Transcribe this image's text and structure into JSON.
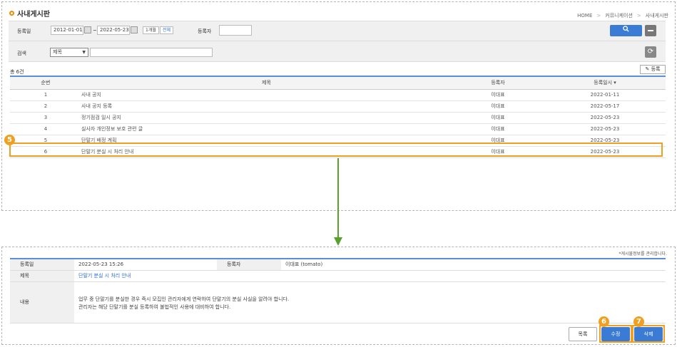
{
  "header": {
    "title": "사내게시판",
    "breadcrumb": [
      "HOME",
      "커뮤니케이션",
      "사내게시판"
    ]
  },
  "search": {
    "date_label": "등록일",
    "date_from": "2012-01-01",
    "date_to": "2022-05-23",
    "tilde": "~",
    "btn_month": "1개월",
    "btn_all": "전체",
    "writer_label": "등록자",
    "writer_value": "",
    "search_label": "검색",
    "search_select": "제목",
    "search_value": "",
    "search_icon": "search-icon",
    "refresh_icon": "refresh-icon"
  },
  "list": {
    "count": "총 6건",
    "register_button": "등록",
    "columns": [
      "순번",
      "제목",
      "등록자",
      "등록일시 ▾"
    ],
    "rows": [
      {
        "no": "1",
        "title": "사내 공지",
        "writer": "이대표",
        "date": "2022-01-11"
      },
      {
        "no": "2",
        "title": "사내 공지 등록",
        "writer": "이대표",
        "date": "2022-05-17"
      },
      {
        "no": "3",
        "title": "정기점검 일시 공지",
        "writer": "이대표",
        "date": "2022-05-23"
      },
      {
        "no": "4",
        "title": "실사자 개인정보 보호 관련 글",
        "writer": "이대표",
        "date": "2022-05-23"
      },
      {
        "no": "5",
        "title": "단말기 배정 계획",
        "writer": "이대표",
        "date": "2022-05-23"
      },
      {
        "no": "6",
        "title": "단말기 분실 시 처리 안내",
        "writer": "이대표",
        "date": "2022-05-23"
      }
    ]
  },
  "markers": {
    "m5": "5",
    "m6": "6",
    "m7": "7"
  },
  "detail": {
    "note": "*게시물정보를 관리합니다.",
    "date_label": "등록일",
    "date_value": "2022-05-23 15:26",
    "writer_label": "등록자",
    "writer_value": "이대표 (tomato)",
    "title_label": "제목",
    "title_value": "단말기 분실 시 처리 안내",
    "content_label": "내용",
    "content_line1": "업무 중 단말기를 분실한 경우 즉시 모집인 관리자에게 연락하여 단말기의 분실 사실을 알려야 합니다.",
    "content_line2": "관리자는 해당 단말기를 분실 등록하여 불법적인 사용에 대비하여 합니다."
  },
  "buttons": {
    "list": "목록",
    "edit": "수정",
    "delete": "삭제"
  },
  "colors": {
    "accent": "#3a7bd5",
    "highlight": "#f0a020",
    "arrow": "#5aa02c"
  }
}
